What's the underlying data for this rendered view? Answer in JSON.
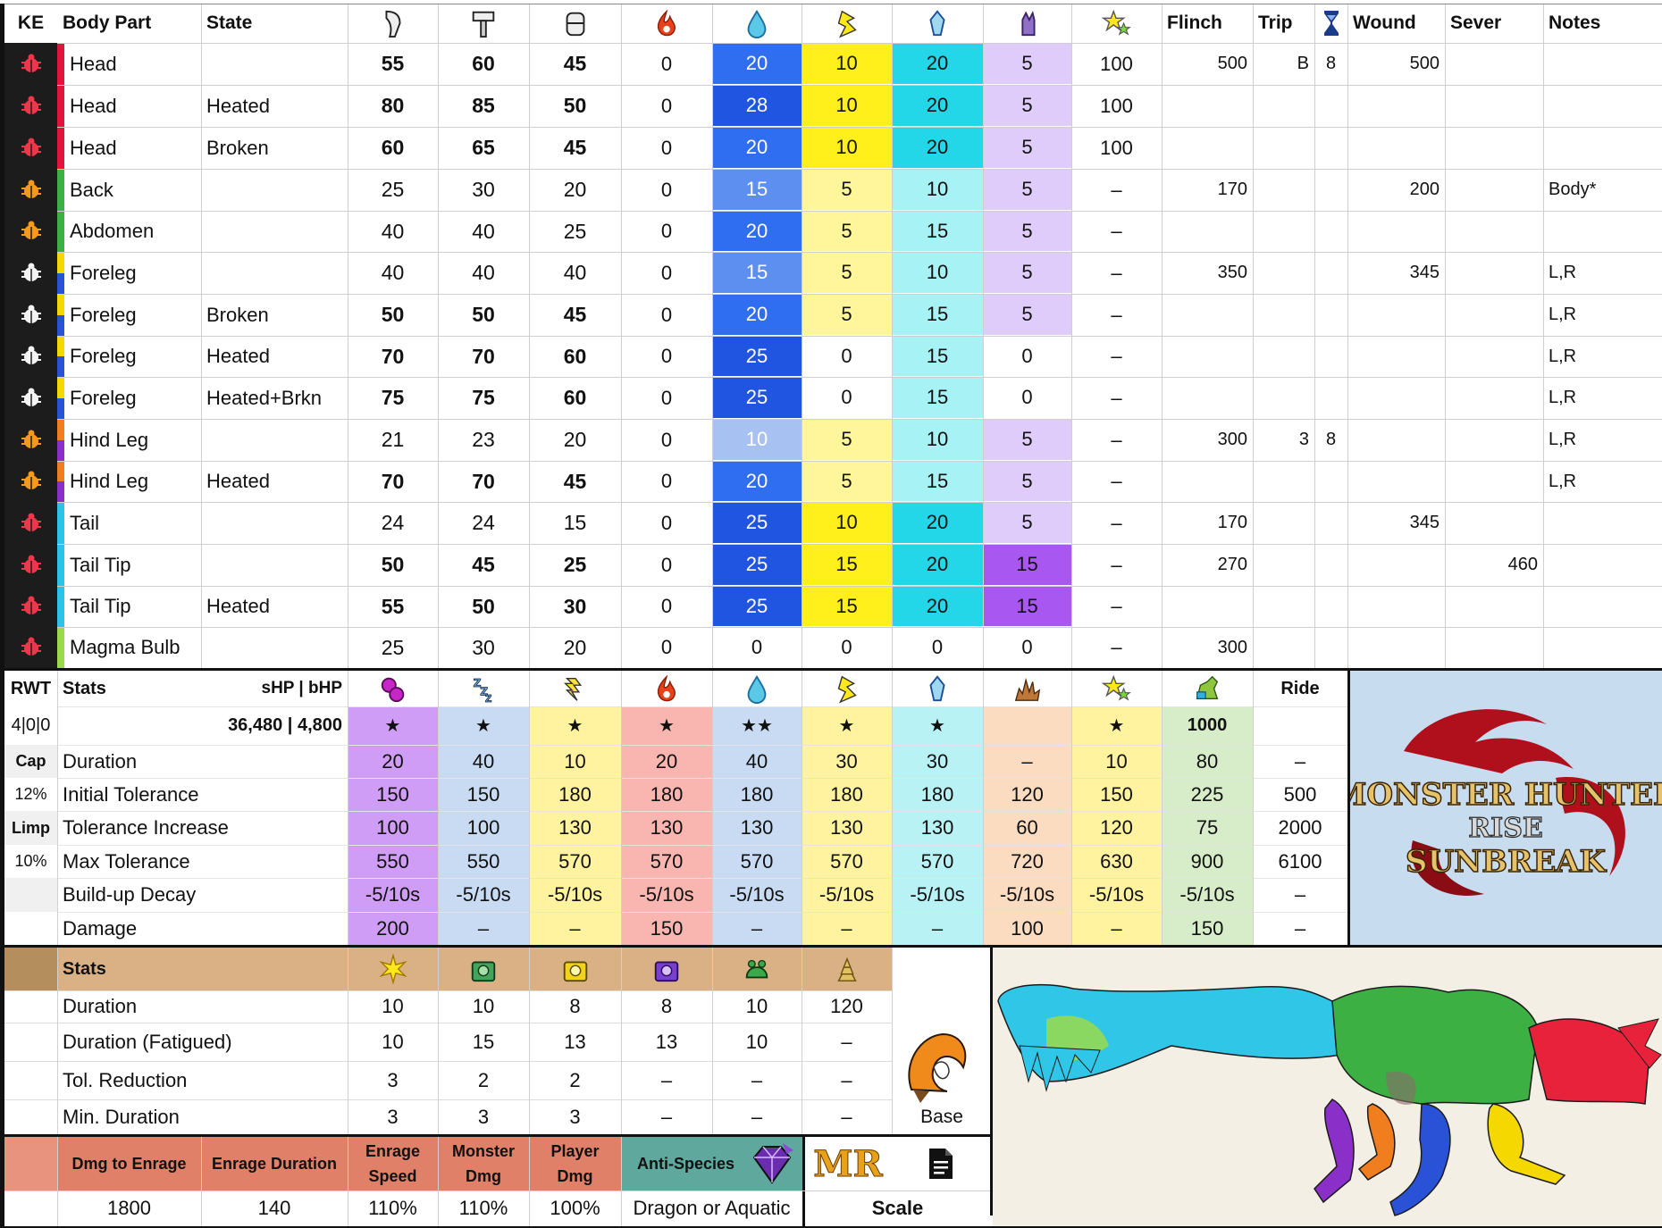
{
  "hitzone": {
    "headers": {
      "ke": "KE",
      "part": "Body Part",
      "state": "State",
      "flinch": "Flinch",
      "trip": "Trip",
      "wound": "Wound",
      "sever": "Sever",
      "notes": "Notes"
    },
    "icons": [
      "sever-icon",
      "blunt-icon",
      "shot-icon",
      "fire-icon",
      "water-icon",
      "thunder-icon",
      "ice-icon",
      "dragon-icon",
      "stun-icon"
    ],
    "rows": [
      {
        "part": "Head",
        "state": "",
        "sev": "55",
        "blu": "60",
        "sht": "45",
        "fir": "0",
        "wat": "20",
        "thu": "10",
        "ice": "20",
        "dra": "5",
        "stn": "100",
        "flinch": "500",
        "trip": "B",
        "trip2": "8",
        "wound": "500",
        "sever": "",
        "notes": "",
        "bold": true,
        "ke": "red",
        "side": "#e3143b"
      },
      {
        "part": "Head",
        "state": "Heated",
        "sev": "80",
        "blu": "85",
        "sht": "50",
        "fir": "0",
        "wat": "28",
        "thu": "10",
        "ice": "20",
        "dra": "5",
        "stn": "100",
        "flinch": "",
        "trip": "",
        "trip2": "",
        "wound": "",
        "sever": "",
        "notes": "",
        "bold": true,
        "ke": "red",
        "side": "#e3143b"
      },
      {
        "part": "Head",
        "state": "Broken",
        "sev": "60",
        "blu": "65",
        "sht": "45",
        "fir": "0",
        "wat": "20",
        "thu": "10",
        "ice": "20",
        "dra": "5",
        "stn": "100",
        "flinch": "",
        "trip": "",
        "trip2": "",
        "wound": "",
        "sever": "",
        "notes": "",
        "bold": true,
        "ke": "red",
        "side": "#e3143b"
      },
      {
        "part": "Back",
        "state": "",
        "sev": "25",
        "blu": "30",
        "sht": "20",
        "fir": "0",
        "wat": "15",
        "thu": "5",
        "ice": "10",
        "dra": "5",
        "stn": "–",
        "flinch": "170",
        "trip": "",
        "trip2": "",
        "wound": "200",
        "sever": "",
        "notes": "Body*",
        "bold": false,
        "ke": "orange",
        "side": "#3cb043"
      },
      {
        "part": "Abdomen",
        "state": "",
        "sev": "40",
        "blu": "40",
        "sht": "25",
        "fir": "0",
        "wat": "20",
        "thu": "5",
        "ice": "15",
        "dra": "5",
        "stn": "–",
        "flinch": "",
        "trip": "",
        "trip2": "",
        "wound": "",
        "sever": "",
        "notes": "",
        "bold": false,
        "ke": "orange",
        "side": "#3cb043"
      },
      {
        "part": "Foreleg",
        "state": "",
        "sev": "40",
        "blu": "40",
        "sht": "40",
        "fir": "0",
        "wat": "15",
        "thu": "5",
        "ice": "10",
        "dra": "5",
        "stn": "–",
        "flinch": "350",
        "trip": "",
        "trip2": "",
        "wound": "345",
        "sever": "",
        "notes": "L,R",
        "bold": false,
        "ke": "white",
        "side": "#f5d800",
        "side2": "#2a52d6"
      },
      {
        "part": "Foreleg",
        "state": "Broken",
        "sev": "50",
        "blu": "50",
        "sht": "45",
        "fir": "0",
        "wat": "20",
        "thu": "5",
        "ice": "15",
        "dra": "5",
        "stn": "–",
        "flinch": "",
        "trip": "",
        "trip2": "",
        "wound": "",
        "sever": "",
        "notes": "L,R",
        "bold": true,
        "ke": "white",
        "side": "#f5d800",
        "side2": "#2a52d6"
      },
      {
        "part": "Foreleg",
        "state": "Heated",
        "sev": "70",
        "blu": "70",
        "sht": "60",
        "fir": "0",
        "wat": "25",
        "thu": "0",
        "ice": "15",
        "dra": "0",
        "stn": "–",
        "flinch": "",
        "trip": "",
        "trip2": "",
        "wound": "",
        "sever": "",
        "notes": "L,R",
        "bold": true,
        "ke": "white",
        "side": "#f5d800",
        "side2": "#2a52d6"
      },
      {
        "part": "Foreleg",
        "state": "Heated+Brkn",
        "sev": "75",
        "blu": "75",
        "sht": "60",
        "fir": "0",
        "wat": "25",
        "thu": "0",
        "ice": "15",
        "dra": "0",
        "stn": "–",
        "flinch": "",
        "trip": "",
        "trip2": "",
        "wound": "",
        "sever": "",
        "notes": "L,R",
        "bold": true,
        "ke": "white",
        "side": "#f5d800",
        "side2": "#2a52d6"
      },
      {
        "part": "Hind Leg",
        "state": "",
        "sev": "21",
        "blu": "23",
        "sht": "20",
        "fir": "0",
        "wat": "10",
        "thu": "5",
        "ice": "10",
        "dra": "5",
        "stn": "–",
        "flinch": "300",
        "trip": "3",
        "trip2": "8",
        "wound": "",
        "sever": "",
        "notes": "L,R",
        "bold": false,
        "ke": "orange",
        "side": "#f07d1e",
        "side2": "#8b2fc9"
      },
      {
        "part": "Hind Leg",
        "state": "Heated",
        "sev": "70",
        "blu": "70",
        "sht": "45",
        "fir": "0",
        "wat": "20",
        "thu": "5",
        "ice": "15",
        "dra": "5",
        "stn": "–",
        "flinch": "",
        "trip": "",
        "trip2": "",
        "wound": "",
        "sever": "",
        "notes": "L,R",
        "bold": true,
        "ke": "orange",
        "side": "#f07d1e",
        "side2": "#8b2fc9"
      },
      {
        "part": "Tail",
        "state": "",
        "sev": "24",
        "blu": "24",
        "sht": "15",
        "fir": "0",
        "wat": "25",
        "thu": "10",
        "ice": "20",
        "dra": "5",
        "stn": "–",
        "flinch": "170",
        "trip": "",
        "trip2": "",
        "wound": "345",
        "sever": "",
        "notes": "",
        "bold": false,
        "ke": "red",
        "side": "#2bc3e8"
      },
      {
        "part": "Tail Tip",
        "state": "",
        "sev": "50",
        "blu": "45",
        "sht": "25",
        "fir": "0",
        "wat": "25",
        "thu": "15",
        "ice": "20",
        "dra": "15",
        "stn": "–",
        "flinch": "270",
        "trip": "",
        "trip2": "",
        "wound": "",
        "sever": "460",
        "notes": "",
        "bold": true,
        "ke": "red",
        "side": "#2bc3e8"
      },
      {
        "part": "Tail Tip",
        "state": "Heated",
        "sev": "55",
        "blu": "50",
        "sht": "30",
        "fir": "0",
        "wat": "25",
        "thu": "15",
        "ice": "20",
        "dra": "15",
        "stn": "–",
        "flinch": "",
        "trip": "",
        "trip2": "",
        "wound": "",
        "sever": "",
        "notes": "",
        "bold": true,
        "ke": "red",
        "side": "#2bc3e8"
      },
      {
        "part": "Magma Bulb",
        "state": "",
        "sev": "25",
        "blu": "30",
        "sht": "20",
        "fir": "0",
        "wat": "0",
        "thu": "0",
        "ice": "0",
        "dra": "0",
        "stn": "–",
        "flinch": "300",
        "trip": "",
        "trip2": "",
        "wound": "",
        "sever": "",
        "notes": "",
        "bold": false,
        "ke": "red",
        "side": "#9ad94a"
      }
    ]
  },
  "status": {
    "rwt": "RWT",
    "stats": "Stats",
    "shp_bhp": "sHP  |  bHP",
    "ride": "Ride",
    "icons": [
      "poison-icon",
      "sleep-icon",
      "paralysis-icon",
      "blast-icon",
      "waterblight-icon",
      "thunderblight-icon",
      "iceblight-icon",
      "exhaust-icon",
      "stun-icon",
      "mount-icon"
    ],
    "rwt_value": "4|0|0",
    "hp_value": "36,480 | 4,800",
    "stars": [
      "★",
      "★",
      "★",
      "★",
      "★★",
      "★",
      "★",
      "",
      "★",
      "1000"
    ],
    "left_labels": [
      "Cap",
      "12%",
      "Limp",
      "10%",
      "",
      ""
    ],
    "rows": [
      {
        "label": "Duration",
        "vals": [
          "20",
          "40",
          "10",
          "20",
          "40",
          "30",
          "30",
          "–",
          "10",
          "80"
        ],
        "ride": "–"
      },
      {
        "label": "Initial Tolerance",
        "vals": [
          "150",
          "150",
          "180",
          "180",
          "180",
          "180",
          "180",
          "120",
          "150",
          "225"
        ],
        "ride": "500"
      },
      {
        "label": "Tolerance Increase",
        "vals": [
          "100",
          "100",
          "130",
          "130",
          "130",
          "130",
          "130",
          "60",
          "120",
          "75"
        ],
        "ride": "2000"
      },
      {
        "label": "Max Tolerance",
        "vals": [
          "550",
          "550",
          "570",
          "570",
          "570",
          "570",
          "570",
          "720",
          "630",
          "900"
        ],
        "ride": "6100"
      },
      {
        "label": "Build-up Decay",
        "vals": [
          "-5/10s",
          "-5/10s",
          "-5/10s",
          "-5/10s",
          "-5/10s",
          "-5/10s",
          "-5/10s",
          "-5/10s",
          "-5/10s",
          "-5/10s"
        ],
        "ride": "–"
      },
      {
        "label": "Damage",
        "vals": [
          "200",
          "–",
          "–",
          "150",
          "–",
          "–",
          "–",
          "100",
          "–",
          "150"
        ],
        "ride": "–"
      }
    ]
  },
  "traps": {
    "stats": "Stats",
    "icons": [
      "flash-icon",
      "shock-trap-icon",
      "pitfall-trap-icon",
      "paralysis-trap-icon",
      "pitfall-icon",
      "dung-icon"
    ],
    "rows": [
      {
        "label": "Duration",
        "vals": [
          "10",
          "10",
          "8",
          "8",
          "10",
          "120"
        ]
      },
      {
        "label": "Duration (Fatigued)",
        "vals": [
          "10",
          "15",
          "13",
          "13",
          "10",
          "–"
        ]
      },
      {
        "label": "Tol. Reduction",
        "vals": [
          "3",
          "2",
          "2",
          "–",
          "–",
          "–"
        ]
      },
      {
        "label": "Min. Duration",
        "vals": [
          "3",
          "3",
          "3",
          "–",
          "–",
          "–"
        ]
      }
    ],
    "base": "Base"
  },
  "enrage": {
    "headers": [
      "Dmg to Enrage",
      "Enrage Duration",
      "Enrage Speed",
      "Monster Dmg",
      "Player Dmg"
    ],
    "vals": [
      "1800",
      "140",
      "110%",
      "110%",
      "100%"
    ],
    "anti_label": "Anti-Species",
    "anti_value": "Dragon or Aquatic",
    "mr": "MR",
    "scale": "Scale"
  },
  "logo": {
    "line1": "MONSTER HUNTER",
    "line2": "RISE",
    "line3": "SUNBREAK"
  },
  "colors": {
    "water_dark": "#1f55e0",
    "water_mid": "#2f6ef0",
    "water_light": "#5d8ff0",
    "water_pale": "#a7c1f2",
    "thunder": "#ffef1a",
    "thunder_pale": "#fff59a",
    "ice": "#23d6e8",
    "ice_pale": "#a6f2f5",
    "dragon": "#a858f0",
    "dragon_pale": "#e0ccfb",
    "enrage_header": "#e08068",
    "trap_header": "#d9b184",
    "anti_header": "#5ea89e"
  }
}
